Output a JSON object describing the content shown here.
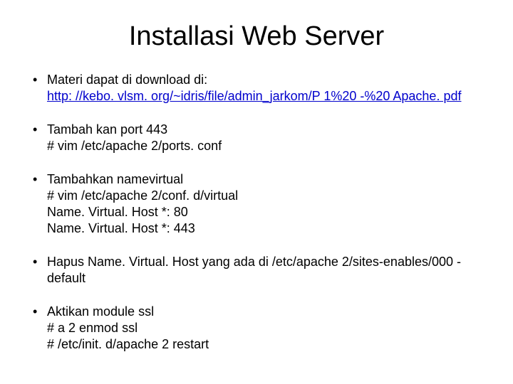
{
  "title": "Installasi Web Server",
  "bullets": [
    {
      "lead": "Materi dapat di download di:",
      "link_text": "http: //kebo. vlsm. org/~idris/file/admin_jarkom/P 1%20 -%20 Apache. pdf"
    },
    {
      "line1": "Tambah kan port 443",
      "line2": "# vim /etc/apache 2/ports. conf"
    },
    {
      "line1": "Tambahkan namevirtual",
      "line2": "# vim /etc/apache 2/conf. d/virtual",
      "line3": "Name. Virtual. Host *: 80",
      "line4": "Name. Virtual. Host *: 443"
    },
    {
      "line1": "Hapus Name. Virtual. Host yang ada di /etc/apache 2/sites-enables/000 -default"
    },
    {
      "line1": "Aktikan module ssl",
      "line2": "# a 2 enmod ssl",
      "line3": "# /etc/init. d/apache 2 restart"
    }
  ]
}
